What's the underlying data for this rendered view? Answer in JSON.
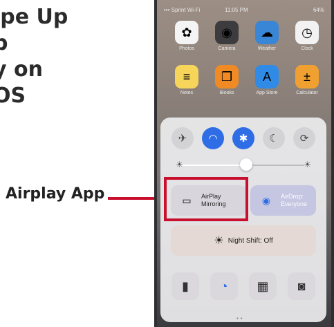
{
  "instructions": {
    "lines": [
      "ipe Up",
      "p",
      "y on",
      "OS",
      "."
    ]
  },
  "callout": {
    "label": "Airplay App"
  },
  "status_bar": {
    "carrier": "••• Sprint Wi-Fi",
    "time": "11:05 PM",
    "battery": "64%"
  },
  "home_apps": [
    {
      "name": "Photos",
      "icon": "photos-icon",
      "glyph": "✿",
      "color": "#f4f4f4"
    },
    {
      "name": "Camera",
      "icon": "camera-icon",
      "glyph": "◉",
      "color": "#3c3c3e"
    },
    {
      "name": "Weather",
      "icon": "weather-icon",
      "glyph": "☁",
      "color": "#3a86d6"
    },
    {
      "name": "Clock",
      "icon": "clock-icon",
      "glyph": "◷",
      "color": "#f2f2f2"
    },
    {
      "name": "Notes",
      "icon": "notes-icon",
      "glyph": "≡",
      "color": "#f7d45a"
    },
    {
      "name": "iBooks",
      "icon": "ibooks-icon",
      "glyph": "❒",
      "color": "#f08a24"
    },
    {
      "name": "App Store",
      "icon": "app-store-icon",
      "glyph": "A",
      "color": "#2f8be6"
    },
    {
      "name": "Calculator",
      "icon": "calculator-icon",
      "glyph": "±",
      "color": "#f0a030"
    }
  ],
  "control_center": {
    "toggles": [
      {
        "name": "airplane-mode-toggle",
        "icon": "airplane-icon",
        "glyph": "✈",
        "state": "off"
      },
      {
        "name": "wifi-toggle",
        "icon": "wifi-icon",
        "glyph": "◠",
        "state": "on"
      },
      {
        "name": "bluetooth-toggle",
        "icon": "bluetooth-icon",
        "glyph": "✱",
        "state": "on"
      },
      {
        "name": "do-not-disturb-toggle",
        "icon": "moon-icon",
        "glyph": "☾",
        "state": "off"
      },
      {
        "name": "rotation-lock-toggle",
        "icon": "rotation-lock-icon",
        "glyph": "⟳",
        "state": "off"
      }
    ],
    "brightness": 0.52,
    "airplay": {
      "line1": "AirPlay",
      "line2": "Mirroring"
    },
    "airdrop": {
      "line1": "AirDrop:",
      "line2": "Everyone"
    },
    "night_shift": "Night Shift: Off",
    "quick_actions": [
      {
        "name": "flashlight-button",
        "icon": "flashlight-icon",
        "glyph": "▮"
      },
      {
        "name": "timer-button",
        "icon": "timer-icon",
        "glyph": "◔"
      },
      {
        "name": "calculator-button",
        "icon": "calculator-icon",
        "glyph": "▦"
      },
      {
        "name": "camera-button",
        "icon": "camera-icon",
        "glyph": "◙"
      }
    ],
    "page_dots": "••"
  },
  "colors": {
    "accent_blue": "#2e6de6",
    "highlight_red": "#c8102e"
  }
}
